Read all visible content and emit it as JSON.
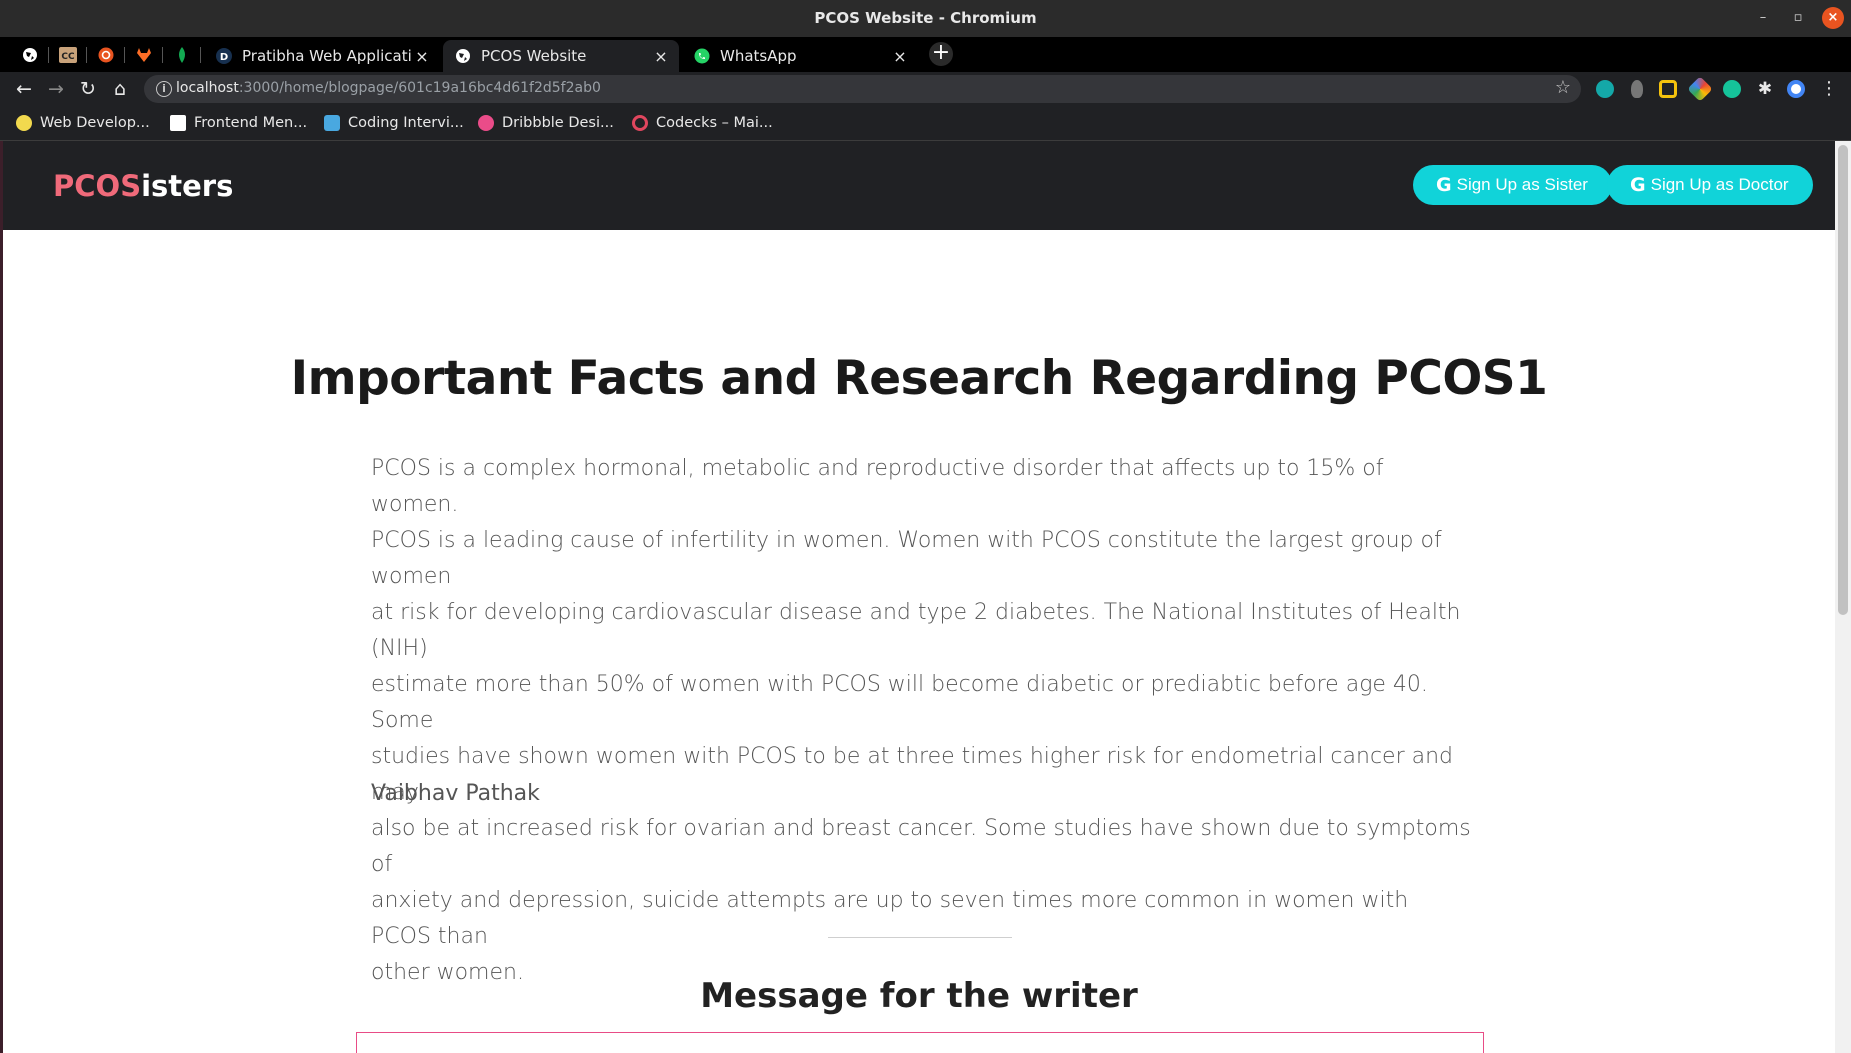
{
  "window": {
    "title": "PCOS Website - Chromium"
  },
  "tabs": [
    {
      "label": "Pratibha Web Application"
    },
    {
      "label": "PCOS Website"
    },
    {
      "label": "WhatsApp"
    }
  ],
  "omnibox": {
    "host": "localhost",
    "path": ":3000/home/blogpage/601c19a16bc4d61f2d5f2ab0"
  },
  "bookmarks": [
    {
      "label": "Web Develop..."
    },
    {
      "label": "Frontend Men..."
    },
    {
      "label": "Coding Intervi..."
    },
    {
      "label": "Dribbble Desi..."
    },
    {
      "label": "Codecks – Mai..."
    }
  ],
  "site": {
    "brand_part1": "PCOS",
    "brand_part2": "isters",
    "signup_sister": "Sign Up as Sister",
    "signup_doctor": "Sign Up as Doctor"
  },
  "article": {
    "title": "Important Facts and Research Regarding PCOS1",
    "lines": [
      "PCOS is a complex hormonal, metabolic and reproductive disorder that affects up to 15% of women.",
      "PCOS is a leading cause of infertility in women. Women with PCOS constitute the largest group of women",
      "at risk for developing cardiovascular disease and type 2 diabetes. The National Institutes of Health (NIH)",
      "estimate more than 50% of women with PCOS will become diabetic or prediabtic before age 40. Some",
      "studies have shown women with PCOS to be at three times higher risk for endometrial cancer and may",
      "also be at increased risk for ovarian and breast cancer. Some studies have shown due to symptoms of",
      "anxiety and depression, suicide attempts are up to seven times more common in women with PCOS than",
      "other women."
    ],
    "author": "Vaibhav Pathak"
  },
  "message": {
    "heading": "Message for the writer"
  },
  "colors": {
    "brand_accent": "#f06a7a",
    "button_bg": "#11d3d9",
    "message_border": "#e84c86",
    "navbar_bg": "#202124"
  }
}
